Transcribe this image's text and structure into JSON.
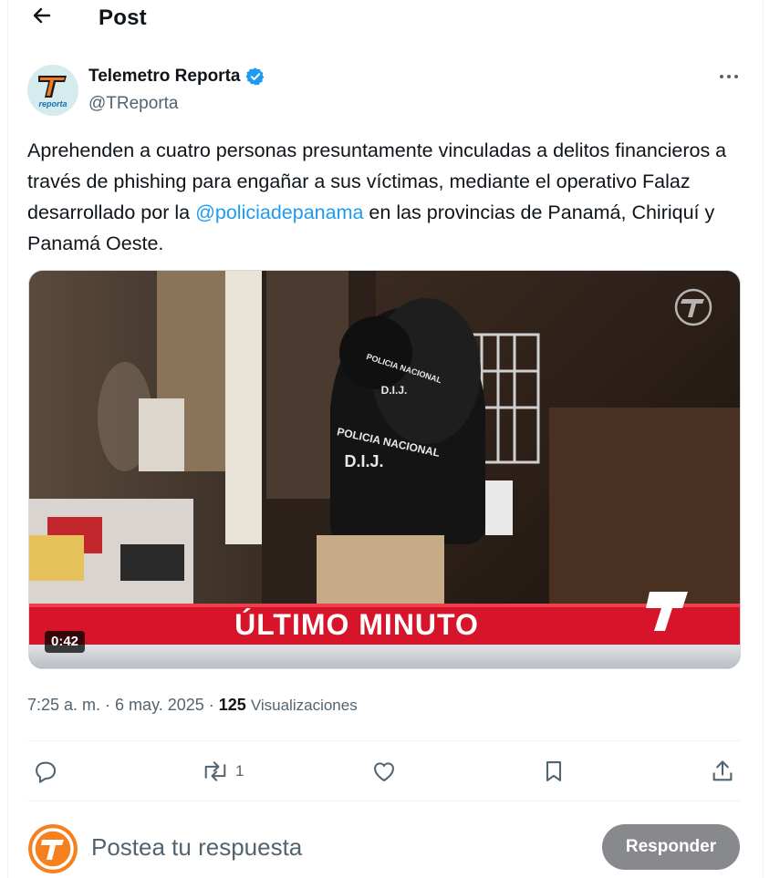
{
  "header": {
    "title": "Post"
  },
  "author": {
    "name": "Telemetro Reporta",
    "handle": "@TReporta",
    "avatar_text": "reporta",
    "verified": true
  },
  "post": {
    "text_before": "Aprehenden a cuatro personas presuntamente vinculadas a delitos financieros a través de phishing para engañar a sus víctimas, mediante el operativo Falaz desarrollado por la ",
    "mention": "@policiadepanama",
    "text_after": " en las provincias de Panamá, Chiriquí y Panamá Oeste."
  },
  "video": {
    "duration": "0:42",
    "banner": "ÚLTIMO MINUTO",
    "vest_line1": "POLICIA NACIONAL",
    "vest_line2": "D.I.J.",
    "vest2_line1": "POLICIA NACIONAL",
    "vest2_line2": "D.I.J."
  },
  "meta": {
    "time": "7:25 a. m.",
    "sep": " · ",
    "date": "6 may. 2025",
    "views_count": "125",
    "views_label": "Visualizaciones"
  },
  "actions": {
    "repost_count": "1"
  },
  "reply": {
    "placeholder": "Postea tu respuesta",
    "button": "Responder"
  },
  "colors": {
    "link": "#1d9bf0",
    "muted": "#536471",
    "verified": "#1d9bf0",
    "banner_red": "#d6152a",
    "button_disabled": "#87898c"
  },
  "icons": [
    "back-arrow-icon",
    "verified-badge-icon",
    "more-icon",
    "reply-icon",
    "repost-icon",
    "like-icon",
    "bookmark-icon",
    "share-icon",
    "channel-logo-icon"
  ]
}
